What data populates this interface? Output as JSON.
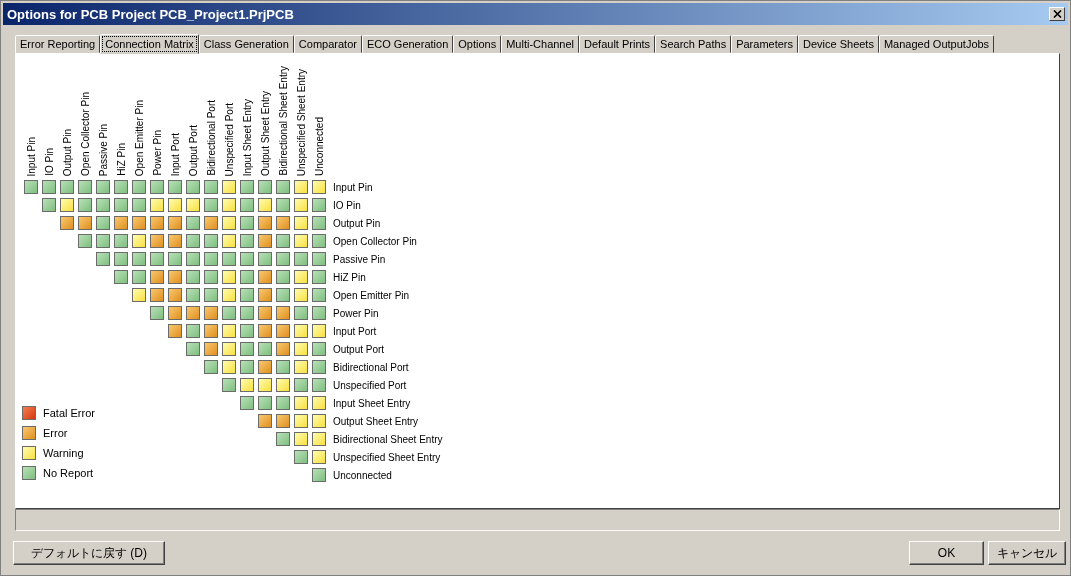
{
  "window": {
    "title": "Options for PCB Project PCB_Project1.PrjPCB"
  },
  "tabs": [
    {
      "label": "Error Reporting",
      "selected": false
    },
    {
      "label": "Connection Matrix",
      "selected": true
    },
    {
      "label": "Class Generation",
      "selected": false
    },
    {
      "label": "Comparator",
      "selected": false
    },
    {
      "label": "ECO Generation",
      "selected": false
    },
    {
      "label": "Options",
      "selected": false
    },
    {
      "label": "Multi-Channel",
      "selected": false
    },
    {
      "label": "Default Prints",
      "selected": false
    },
    {
      "label": "Search Paths",
      "selected": false
    },
    {
      "label": "Parameters",
      "selected": false
    },
    {
      "label": "Device Sheets",
      "selected": false
    },
    {
      "label": "Managed OutputJobs",
      "selected": false
    }
  ],
  "matrix": {
    "columns": [
      "Input Pin",
      "IO Pin",
      "Output Pin",
      "Open Collector Pin",
      "Passive Pin",
      "HiZ Pin",
      "Open Emitter Pin",
      "Power Pin",
      "Input Port",
      "Output Port",
      "Bidirectional Port",
      "Unspecified Port",
      "Input Sheet Entry",
      "Output Sheet Entry",
      "Bidirectional Sheet Entry",
      "Unspecified Sheet Entry",
      "Unconnected"
    ],
    "rows": [
      {
        "label": "Input Pin",
        "cells": [
          {
            "kind": "no_report"
          },
          {
            "kind": "no_report"
          },
          {
            "kind": "no_report"
          },
          {
            "kind": "no_report"
          },
          {
            "kind": "no_report"
          },
          {
            "kind": "no_report"
          },
          {
            "kind": "no_report"
          },
          {
            "kind": "no_report"
          },
          {
            "kind": "no_report"
          },
          {
            "kind": "no_report"
          },
          {
            "kind": "no_report"
          },
          {
            "kind": "warning"
          },
          {
            "kind": "no_report"
          },
          {
            "kind": "no_report"
          },
          {
            "kind": "no_report"
          },
          {
            "kind": "warning"
          },
          {
            "kind": "warning"
          }
        ]
      },
      {
        "label": "IO Pin",
        "cells": [
          {
            "kind": "no_report"
          },
          {
            "kind": "warning"
          },
          {
            "kind": "no_report"
          },
          {
            "kind": "no_report"
          },
          {
            "kind": "no_report"
          },
          {
            "kind": "no_report"
          },
          {
            "kind": "warning"
          },
          {
            "kind": "warning"
          },
          {
            "kind": "warning"
          },
          {
            "kind": "no_report"
          },
          {
            "kind": "warning"
          },
          {
            "kind": "no_report"
          },
          {
            "kind": "warning"
          },
          {
            "kind": "no_report"
          },
          {
            "kind": "warning"
          },
          {
            "kind": "no_report"
          }
        ]
      },
      {
        "label": "Output Pin",
        "cells": [
          {
            "kind": "error"
          },
          {
            "kind": "error"
          },
          {
            "kind": "no_report"
          },
          {
            "kind": "error"
          },
          {
            "kind": "error"
          },
          {
            "kind": "error"
          },
          {
            "kind": "error"
          },
          {
            "kind": "no_report"
          },
          {
            "kind": "error"
          },
          {
            "kind": "warning"
          },
          {
            "kind": "no_report"
          },
          {
            "kind": "error"
          },
          {
            "kind": "error"
          },
          {
            "kind": "warning"
          },
          {
            "kind": "no_report"
          }
        ]
      },
      {
        "label": "Open Collector Pin",
        "cells": [
          {
            "kind": "no_report"
          },
          {
            "kind": "no_report"
          },
          {
            "kind": "no_report"
          },
          {
            "kind": "warning"
          },
          {
            "kind": "error"
          },
          {
            "kind": "error"
          },
          {
            "kind": "no_report"
          },
          {
            "kind": "no_report"
          },
          {
            "kind": "warning"
          },
          {
            "kind": "no_report"
          },
          {
            "kind": "error"
          },
          {
            "kind": "no_report"
          },
          {
            "kind": "warning"
          },
          {
            "kind": "no_report"
          }
        ]
      },
      {
        "label": "Passive Pin",
        "cells": [
          {
            "kind": "no_report"
          },
          {
            "kind": "no_report"
          },
          {
            "kind": "no_report"
          },
          {
            "kind": "no_report"
          },
          {
            "kind": "no_report"
          },
          {
            "kind": "no_report"
          },
          {
            "kind": "no_report"
          },
          {
            "kind": "no_report"
          },
          {
            "kind": "no_report"
          },
          {
            "kind": "no_report"
          },
          {
            "kind": "no_report"
          },
          {
            "kind": "no_report"
          },
          {
            "kind": "no_report"
          }
        ]
      },
      {
        "label": "HiZ Pin",
        "cells": [
          {
            "kind": "no_report"
          },
          {
            "kind": "no_report"
          },
          {
            "kind": "error"
          },
          {
            "kind": "error"
          },
          {
            "kind": "no_report"
          },
          {
            "kind": "no_report"
          },
          {
            "kind": "warning"
          },
          {
            "kind": "no_report"
          },
          {
            "kind": "error"
          },
          {
            "kind": "no_report"
          },
          {
            "kind": "warning"
          },
          {
            "kind": "no_report"
          }
        ]
      },
      {
        "label": "Open Emitter Pin",
        "cells": [
          {
            "kind": "warning"
          },
          {
            "kind": "error"
          },
          {
            "kind": "error"
          },
          {
            "kind": "no_report"
          },
          {
            "kind": "no_report"
          },
          {
            "kind": "warning"
          },
          {
            "kind": "no_report"
          },
          {
            "kind": "error"
          },
          {
            "kind": "no_report"
          },
          {
            "kind": "warning"
          },
          {
            "kind": "no_report"
          }
        ]
      },
      {
        "label": "Power Pin",
        "cells": [
          {
            "kind": "no_report"
          },
          {
            "kind": "error"
          },
          {
            "kind": "error"
          },
          {
            "kind": "error"
          },
          {
            "kind": "no_report"
          },
          {
            "kind": "no_report"
          },
          {
            "kind": "error"
          },
          {
            "kind": "error"
          },
          {
            "kind": "no_report"
          },
          {
            "kind": "no_report"
          }
        ]
      },
      {
        "label": "Input Port",
        "cells": [
          {
            "kind": "error"
          },
          {
            "kind": "no_report"
          },
          {
            "kind": "error"
          },
          {
            "kind": "warning"
          },
          {
            "kind": "no_report"
          },
          {
            "kind": "error"
          },
          {
            "kind": "error"
          },
          {
            "kind": "warning"
          },
          {
            "kind": "warning"
          }
        ]
      },
      {
        "label": "Output Port",
        "cells": [
          {
            "kind": "no_report"
          },
          {
            "kind": "error"
          },
          {
            "kind": "warning"
          },
          {
            "kind": "no_report"
          },
          {
            "kind": "no_report"
          },
          {
            "kind": "error"
          },
          {
            "kind": "warning"
          },
          {
            "kind": "no_report"
          }
        ]
      },
      {
        "label": "Bidirectional Port",
        "cells": [
          {
            "kind": "no_report"
          },
          {
            "kind": "warning"
          },
          {
            "kind": "no_report"
          },
          {
            "kind": "error"
          },
          {
            "kind": "no_report"
          },
          {
            "kind": "warning"
          },
          {
            "kind": "no_report"
          }
        ]
      },
      {
        "label": "Unspecified Port",
        "cells": [
          {
            "kind": "no_report"
          },
          {
            "kind": "warning"
          },
          {
            "kind": "warning"
          },
          {
            "kind": "warning"
          },
          {
            "kind": "no_report"
          },
          {
            "kind": "no_report"
          }
        ]
      },
      {
        "label": "Input Sheet Entry",
        "cells": [
          {
            "kind": "no_report"
          },
          {
            "kind": "no_report"
          },
          {
            "kind": "no_report"
          },
          {
            "kind": "warning"
          },
          {
            "kind": "warning"
          }
        ]
      },
      {
        "label": "Output Sheet Entry",
        "cells": [
          {
            "kind": "error"
          },
          {
            "kind": "error"
          },
          {
            "kind": "warning"
          },
          {
            "kind": "warning"
          }
        ]
      },
      {
        "label": "Bidirectional Sheet Entry",
        "cells": [
          {
            "kind": "no_report"
          },
          {
            "kind": "warning"
          },
          {
            "kind": "warning"
          }
        ]
      },
      {
        "label": "Unspecified Sheet Entry",
        "cells": [
          {
            "kind": "no_report"
          },
          {
            "kind": "warning"
          }
        ]
      },
      {
        "label": "Unconnected",
        "cells": [
          {
            "kind": "no_report"
          }
        ]
      }
    ]
  },
  "legend": [
    {
      "kind": "fatal_error",
      "label": "Fatal Error"
    },
    {
      "kind": "error",
      "label": "Error"
    },
    {
      "kind": "warning",
      "label": "Warning"
    },
    {
      "kind": "no_report",
      "label": "No Report"
    }
  ],
  "buttons": {
    "defaults": "デフォルトに戻す (D)",
    "ok": "OK",
    "cancel": "キャンセル"
  }
}
